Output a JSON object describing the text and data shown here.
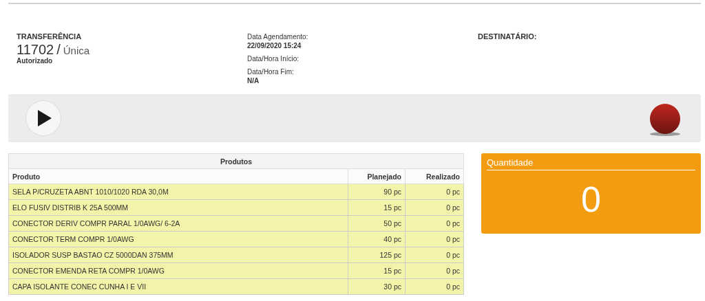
{
  "header": {
    "type_label": "TRANSFERÊNCIA",
    "number": "11702",
    "separator": "/",
    "mode": "Única",
    "status": "Autorizado"
  },
  "dates": [
    {
      "label": "Data Agendamento:",
      "value": "22/09/2020 15:24"
    },
    {
      "label": "Data/Hora Início:"
    },
    {
      "label": "Data/Hora Fim:",
      "value": "N/A"
    }
  ],
  "recipient": {
    "label": "DESTINATÁRIO:"
  },
  "table": {
    "title": "Produtos",
    "columns": [
      "Produto",
      "Planejado",
      "Realizado"
    ],
    "rows": [
      [
        "SELA P/CRUZETA ABNT 1010/1020 RDA 30,0M",
        "90 pc",
        "0 pc"
      ],
      [
        "ELO FUSIV DISTRIB K 25A 500MM",
        "15 pc",
        "0 pc"
      ],
      [
        "CONECTOR DERIV COMPR PARAL 1/0AWG/ 6-2A",
        "50 pc",
        "0 pc"
      ],
      [
        "CONECTOR TERM COMPR 1/0AWG",
        "40 pc",
        "0 pc"
      ],
      [
        "ISOLADOR SUSP BASTAO CZ 5000DAN 375MM",
        "125 pc",
        "0 pc"
      ],
      [
        "CONECTOR EMENDA RETA COMPR 1/0AWG",
        "15 pc",
        "0 pc"
      ],
      [
        "CAPA ISOLANTE CONEC CUNHA I E VII",
        "30 pc",
        "0 pc"
      ]
    ]
  },
  "quantity": {
    "label": "Quantidade",
    "value": "0"
  }
}
